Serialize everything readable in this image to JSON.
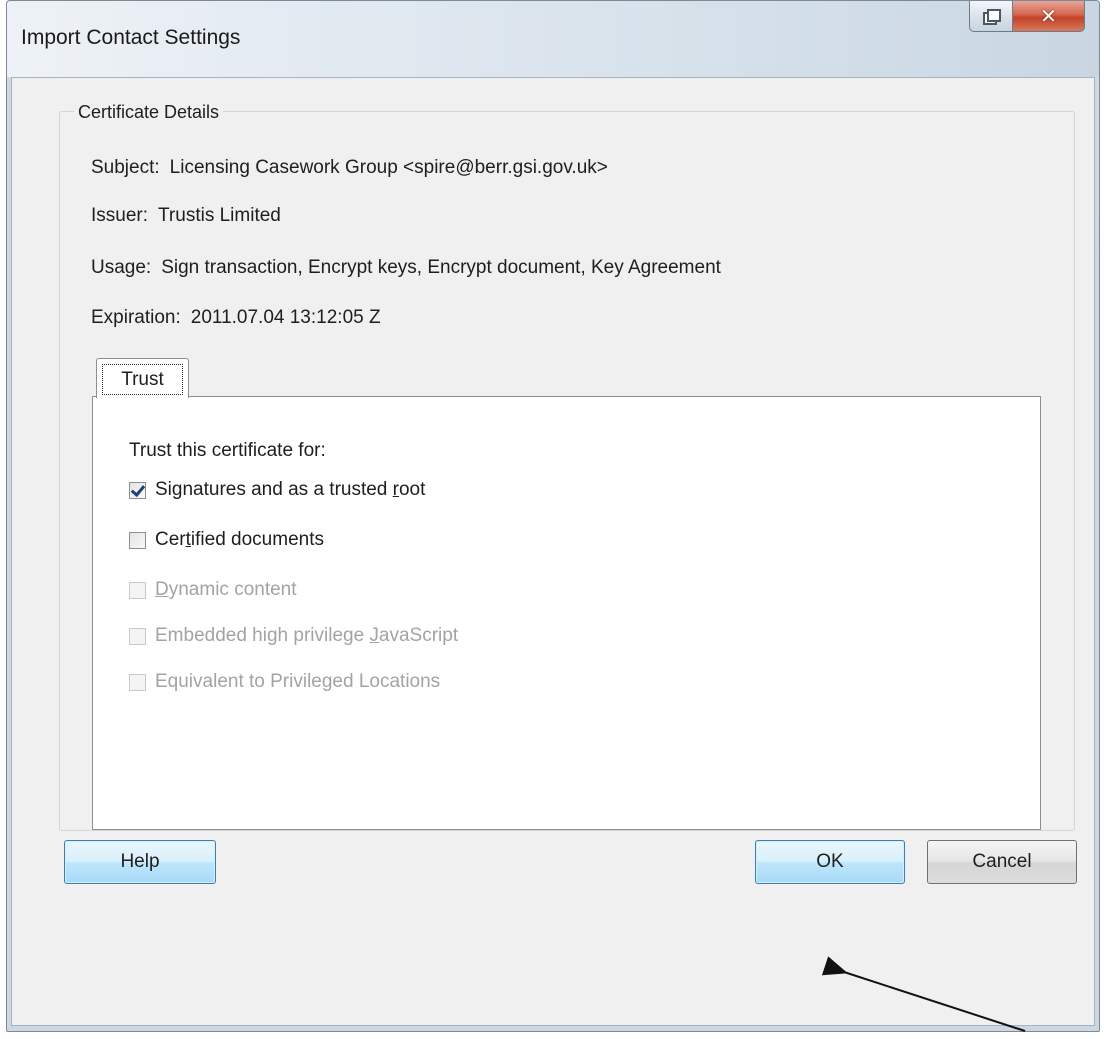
{
  "window": {
    "title": "Import Contact Settings",
    "close_glyph": "✕"
  },
  "details": {
    "legend": "Certificate Details",
    "subject_label": "Subject:",
    "subject_value": "Licensing Casework Group <spire@berr.gsi.gov.uk>",
    "issuer_label": "Issuer:",
    "issuer_value": "Trustis Limited",
    "usage_label": "Usage:",
    "usage_value": "Sign transaction, Encrypt keys, Encrypt document, Key Agreement",
    "expiration_label": "Expiration:",
    "expiration_value": "2011.07.04 13:12:05 Z"
  },
  "tabs": [
    {
      "label": "Trust",
      "selected": true
    }
  ],
  "trust": {
    "heading": "Trust this certificate for:",
    "options": [
      {
        "before": "Signatures and as a trusted ",
        "key": "r",
        "after": "oot",
        "checked": true,
        "enabled": true
      },
      {
        "before": "Cer",
        "key": "t",
        "after": "ified documents",
        "checked": false,
        "enabled": true
      },
      {
        "before": "",
        "key": "D",
        "after": "ynamic content",
        "checked": false,
        "enabled": false
      },
      {
        "before": "Embedded high privilege ",
        "key": "J",
        "after": "avaScript",
        "checked": false,
        "enabled": false
      },
      {
        "before": "Equivalent to Privileged Locations",
        "key": "",
        "after": "",
        "checked": false,
        "enabled": false
      }
    ]
  },
  "buttons": {
    "help": "Help",
    "ok": "OK",
    "cancel": "Cancel"
  },
  "icons": {
    "restore": "restore-icon",
    "close": "close-icon",
    "pointer": "annotation-arrow"
  }
}
